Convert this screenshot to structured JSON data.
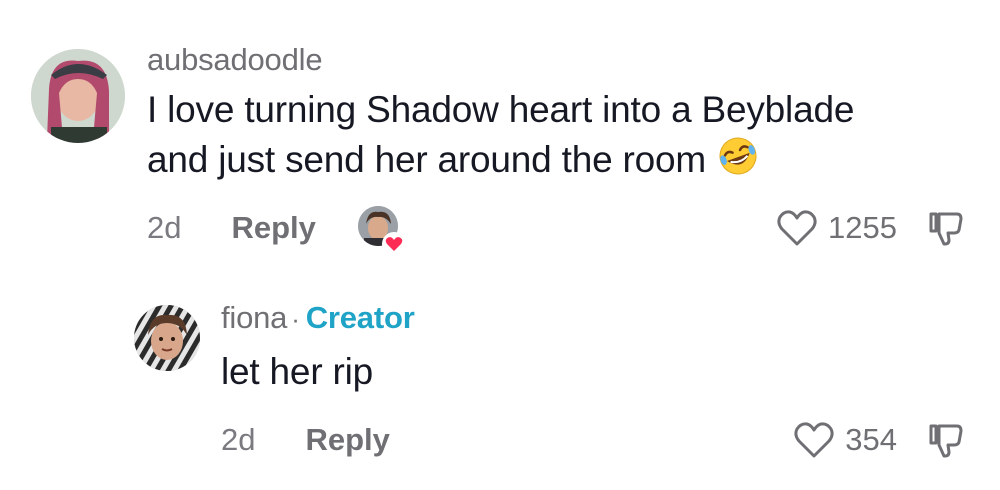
{
  "comments": [
    {
      "username": "aubsadoodle",
      "text_line1": "I love turning Shadow heart into a Beyblade",
      "text_line2": "and just send her around the room",
      "emoji": "rolling-on-floor-laughing-emoji",
      "date": "2d",
      "reply_label": "Reply",
      "likes": "1255",
      "liked_by_creator": true
    },
    {
      "username": "fiona",
      "separator": "·",
      "badge": "Creator",
      "text": "let her rip",
      "date": "2d",
      "reply_label": "Reply",
      "likes": "354"
    }
  ],
  "colors": {
    "text": "#161823",
    "muted": "#6f6f74",
    "creator_badge": "#1fa3c7",
    "heart_badge": "#fe2c55"
  }
}
